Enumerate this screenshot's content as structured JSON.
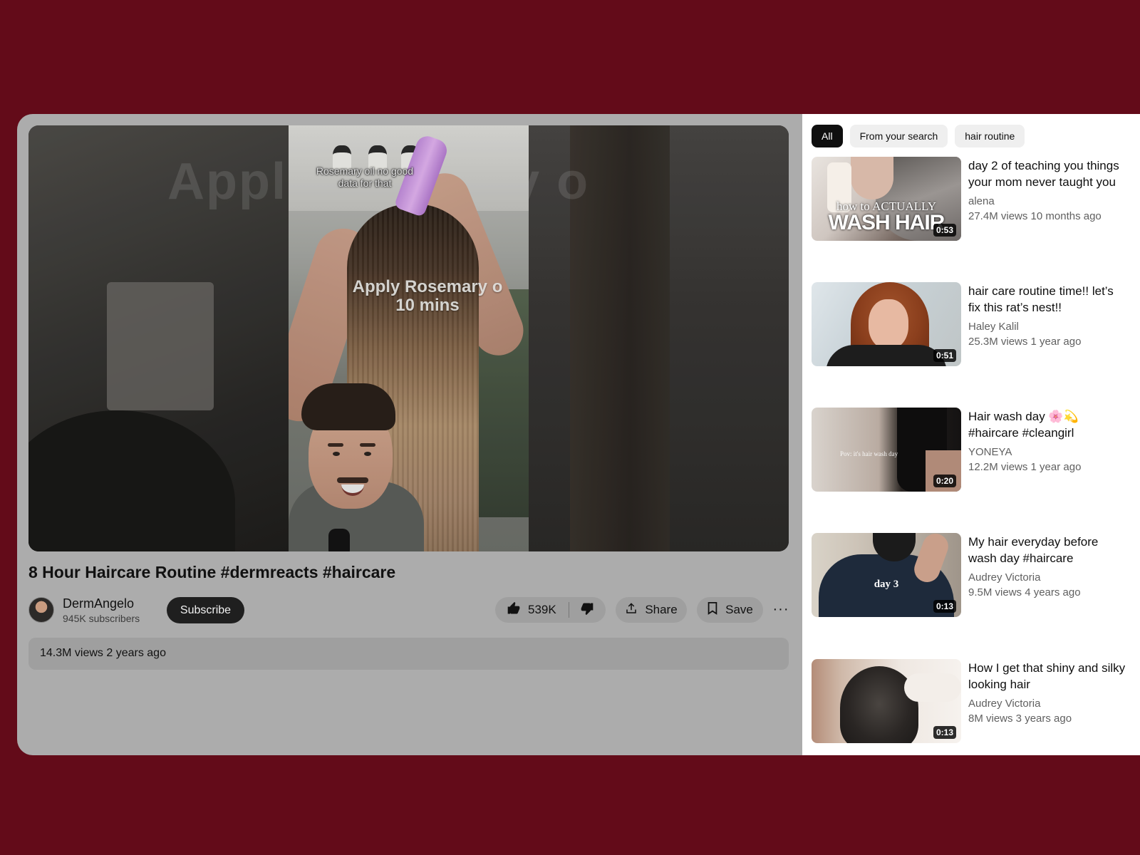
{
  "player": {
    "ghost_caption": "Appl           ary o",
    "caption_top": "Rosemary oil no good data for that",
    "caption_mid": "Apply Rosemary o\n10 mins"
  },
  "video": {
    "title": "8 Hour Haircare Routine #dermreacts #haircare",
    "channel": "DermAngelo",
    "subscribers": "945K subscribers",
    "subscribe_label": "Subscribe",
    "likes": "539K",
    "share_label": "Share",
    "save_label": "Save",
    "more_label": "···",
    "views_date": "14.3M views  2 years ago"
  },
  "sidebar": {
    "chips": [
      "All",
      "From your search",
      "hair routine"
    ],
    "recommendations": [
      {
        "title": "day 2 of teaching you things your mom never taught you",
        "channel": "alena",
        "meta": "27.4M views  10 months ago",
        "duration": "0:53",
        "thumb_text_1": "how to ACTUALLY",
        "thumb_text_2": "WASH HAIR"
      },
      {
        "title": "hair care routine time!! let’s fix this rat’s nest!!",
        "channel": "Haley Kalil",
        "meta": "25.3M views  1 year ago",
        "duration": "0:51"
      },
      {
        "title": "Hair wash day 🌸💫 #haircare #cleangirl",
        "channel": "YONEYA",
        "meta": "12.2M views  1 year ago",
        "duration": "0:20",
        "thumb_text_1": "Pov: it's hair wash day"
      },
      {
        "title": "My hair everyday before wash day #haircare",
        "channel": "Audrey Victoria",
        "meta": "9.5M views  4 years ago",
        "duration": "0:13",
        "thumb_text_1": "day 3"
      },
      {
        "title": "How I get that shiny and silky looking hair",
        "channel": "Audrey Victoria",
        "meta": "8M views  3 years ago",
        "duration": "0:13"
      }
    ]
  },
  "colors": {
    "backdrop": "#630b19",
    "dim_overlay": "#acacac",
    "subscribe_bg": "#1f1f1f",
    "chip_active": "#0f0f0f"
  },
  "icons": [
    "thumbs-up-icon",
    "thumbs-down-icon",
    "share-icon",
    "bookmark-icon",
    "more-icon"
  ]
}
